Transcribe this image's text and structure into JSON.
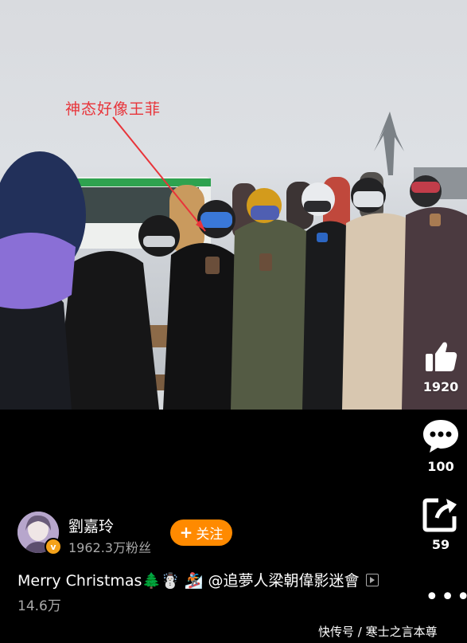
{
  "annotation": {
    "text": "神态好像王菲"
  },
  "actions": {
    "like_count": "1920",
    "comment_count": "100",
    "share_count": "59"
  },
  "author": {
    "name": "劉嘉玲",
    "fans": "1962.3万粉丝",
    "follow_label": "关注",
    "follow_plus": "+"
  },
  "caption": {
    "text": "Merry Christmas🌲☃️ 🏂 @追夢人梁朝偉影迷會",
    "views": "14.6万"
  },
  "more": "•••",
  "watermark": "快传号 / 寒士之言本尊",
  "colors": {
    "follow_button": "#ff8a00",
    "annotation": "#e8343a",
    "secondary_text": "#a9a9a9"
  }
}
